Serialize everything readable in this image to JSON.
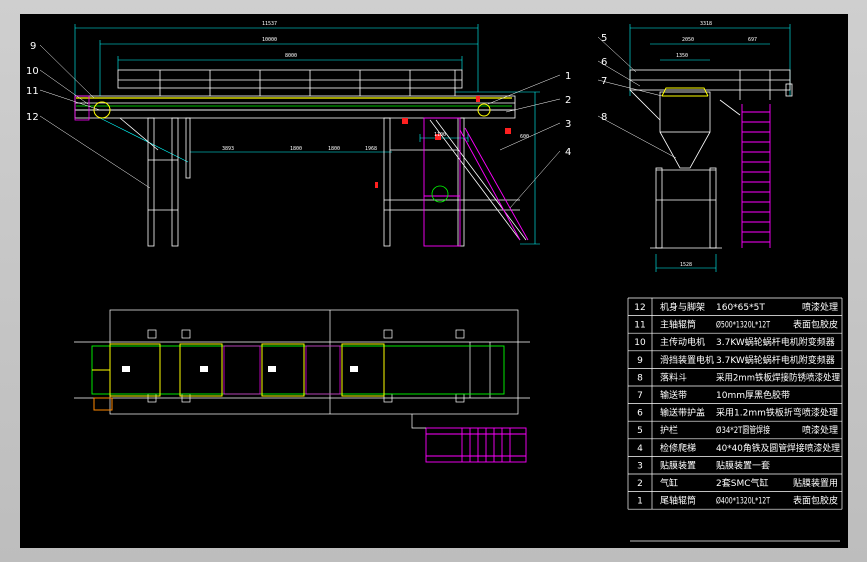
{
  "colors": {
    "background": "#000000",
    "frame": "#c3c3c3",
    "steel": "#ffffff",
    "dimension": "#00ffff",
    "belt": "#ffff00",
    "rail": "#00ff00",
    "ladder": "#ff00ff",
    "marker": "#ff2020",
    "leader": "#ffffff"
  },
  "callouts": [
    "1",
    "2",
    "3",
    "4",
    "5",
    "6",
    "7",
    "8",
    "9",
    "10",
    "11",
    "12"
  ],
  "dimensions": {
    "side_total": "11537",
    "side_belt": "10000",
    "side_inner": "8000",
    "side_a": "3893",
    "side_b": "1800",
    "side_c": "1800",
    "side_d": "1968",
    "side_e": "1100",
    "side_f": "600",
    "end_total": "3318",
    "end_a": "2050",
    "end_b": "697",
    "end_c": "1350",
    "end_base": "1528"
  },
  "bom": {
    "rows": [
      {
        "no": "12",
        "name": "机身与脚架",
        "spec": "160*65*5T",
        "note": "喷漆处理"
      },
      {
        "no": "11",
        "name": "主轴辊筒",
        "spec": "Ø500*1320L*12T",
        "note": "表面包胶皮"
      },
      {
        "no": "10",
        "name": "主传动电机",
        "spec": "3.7KW蜗轮蜗杆电机附变频器",
        "note": ""
      },
      {
        "no": "9",
        "name": "滑挡装置电机",
        "spec": "3.7KW蜗轮蜗杆电机附变频器",
        "note": ""
      },
      {
        "no": "8",
        "name": "落料斗",
        "spec": "采用2mm铁板焊接防锈喷漆处理",
        "note": ""
      },
      {
        "no": "7",
        "name": "输送带",
        "spec": "10mm厚黑色胶带",
        "note": ""
      },
      {
        "no": "6",
        "name": "输送带护盖",
        "spec": "采用1.2mm铁板折弯喷漆处理",
        "note": ""
      },
      {
        "no": "5",
        "name": "护栏",
        "spec": "Ø34*2T圆管焊接",
        "note": "喷漆处理"
      },
      {
        "no": "4",
        "name": "检修爬梯",
        "spec": "40*40角铁及圆管焊接喷漆处理",
        "note": ""
      },
      {
        "no": "3",
        "name": "贴膜装置",
        "spec": "贴膜装置一套",
        "note": ""
      },
      {
        "no": "2",
        "name": "气缸",
        "spec": "2套SMC气缸",
        "note": "贴膜装置用"
      },
      {
        "no": "1",
        "name": "尾轴辊筒",
        "spec": "Ø400*1320L*12T",
        "note": "表面包胶皮"
      }
    ]
  }
}
